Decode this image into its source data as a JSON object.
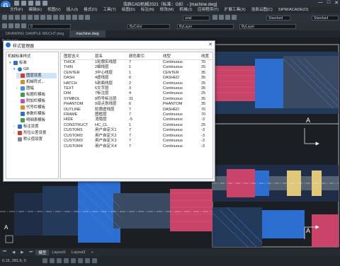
{
  "app": {
    "title": "浩辰CAD机械2021（标准：GB） - [machine.dwg]",
    "logo_letter": "G",
    "window_controls": [
      "—",
      "□",
      "✕"
    ]
  },
  "menubar": [
    "文件(F)",
    "编辑(E)",
    "视图(V)",
    "插入(I)",
    "格式(O)",
    "工具(T)",
    "绘图(D)",
    "标注(N)",
    "修改(M)",
    "机械(J)",
    "应用程序(Y)",
    "扩展工具(X)",
    "浩辰云图(C)",
    "SIPM/ACADE(O)"
  ],
  "toolbar": {
    "layer_combo": "ByLayer",
    "linetype_combo": "ByLayer",
    "color_combo": "ByColor",
    "font_combo": "arial",
    "text_style_combo": "Standard",
    "dimstyle_combo": "Standard",
    "layer_name": "0",
    "point_label": "ReXpoints"
  },
  "doc_tabs": [
    {
      "label": "DRAWING SAMPLE MECHT.dwg",
      "active": false
    },
    {
      "label": "machine.dwg",
      "active": true
    }
  ],
  "drawing": {
    "section_label_a1": "A",
    "section_label_a2": "A",
    "section_label_a3": "A"
  },
  "bottom_tabs": [
    {
      "label": "模型",
      "active": true
    },
    {
      "label": "Layout1",
      "active": false
    },
    {
      "label": "Layout2",
      "active": false
    }
  ],
  "status": {
    "coordinates": "0.15, 281.5, 0"
  },
  "dialog": {
    "title": "样式管理器",
    "close": "✕",
    "tree": [
      {
        "label": "机械标准样式",
        "level": 0,
        "caret": "",
        "icon_color": ""
      },
      {
        "label": "标准",
        "level": 1,
        "caret": "▾",
        "icon_color": "#2e6fd0"
      },
      {
        "label": "GB",
        "level": 2,
        "caret": "▾",
        "icon_color": "#2e6fd0"
      },
      {
        "label": "图层设置",
        "level": 3,
        "caret": "",
        "icon_color": "#d23a3a",
        "selected": true
      },
      {
        "label": "机械符式...",
        "level": 3,
        "caret": "",
        "icon_color": "#e08a24"
      },
      {
        "label": "图幅",
        "level": 3,
        "caret": "›",
        "icon_color": "#4a90d9"
      },
      {
        "label": "标题栏模板",
        "level": 3,
        "caret": "",
        "icon_color": "#3aa14b"
      },
      {
        "label": "附加栏模板",
        "level": 3,
        "caret": "",
        "icon_color": "#c14bc8"
      },
      {
        "label": "代号栏模板",
        "level": 3,
        "caret": "",
        "icon_color": "#e08a24"
      },
      {
        "label": "参数栏模板",
        "level": 3,
        "caret": "",
        "icon_color": "#2e6fd0"
      },
      {
        "label": "明细表模板",
        "level": 3,
        "caret": "",
        "icon_color": "#3aa14b"
      },
      {
        "label": "标注设置",
        "level": 2,
        "caret": "›",
        "icon_color": "#2e6fd0"
      },
      {
        "label": "形位公差设置",
        "level": 2,
        "caret": "›",
        "icon_color": "#d23a3a"
      },
      {
        "label": "默认值设置",
        "level": 2,
        "caret": "",
        "icon_color": "#888888"
      }
    ],
    "grid": {
      "headers": [
        "图层含义",
        "层名",
        "颜色索引",
        "线型",
        "线宽"
      ],
      "rows": [
        [
          "THICK",
          "1轮廓实线层",
          "7",
          "Continuous",
          "70"
        ],
        [
          "THIN",
          "2细线层",
          "1",
          "Continuous",
          "25"
        ],
        [
          "CENTER",
          "3中心线层",
          "1",
          "CENTER",
          "35"
        ],
        [
          "DASH",
          "4虚线层",
          "6",
          "DASHED",
          "35"
        ],
        [
          "HATCH",
          "5剖面线层",
          "2",
          "Continuous",
          "25"
        ],
        [
          "TEXT",
          "6文字层",
          "3",
          "Continuous",
          "35"
        ],
        [
          "DIM",
          "7标注层",
          "4",
          "Continuous",
          "25"
        ],
        [
          "SYMBOL",
          "8符号标注层",
          "31",
          "Continuous",
          "35"
        ],
        [
          "PHANTOM",
          "9双点划线层",
          "6",
          "PHANTOM",
          "35"
        ],
        [
          "OUTLINE",
          "轮廓虚线层",
          "7",
          "DASHED",
          "70"
        ],
        [
          "FRAME",
          "图框层",
          "7",
          "Continuous",
          "70"
        ],
        [
          "HIDE",
          "消隐层",
          "-5",
          "Continuous",
          "-3"
        ],
        [
          "CONSTRUCT",
          "HC_CL",
          "1",
          "Continuous",
          "25"
        ],
        [
          "CUSTOM1",
          "用户自定义1",
          "7",
          "Continuous",
          "-3"
        ],
        [
          "CUSTOM2",
          "用户自定义2",
          "7",
          "Continuous",
          "-3"
        ],
        [
          "CUSTOM3",
          "用户自定义3",
          "7",
          "Continuous",
          "-3"
        ],
        [
          "CUSTOM4",
          "用户自定义4",
          "7",
          "Continuous",
          "-3"
        ]
      ]
    }
  }
}
